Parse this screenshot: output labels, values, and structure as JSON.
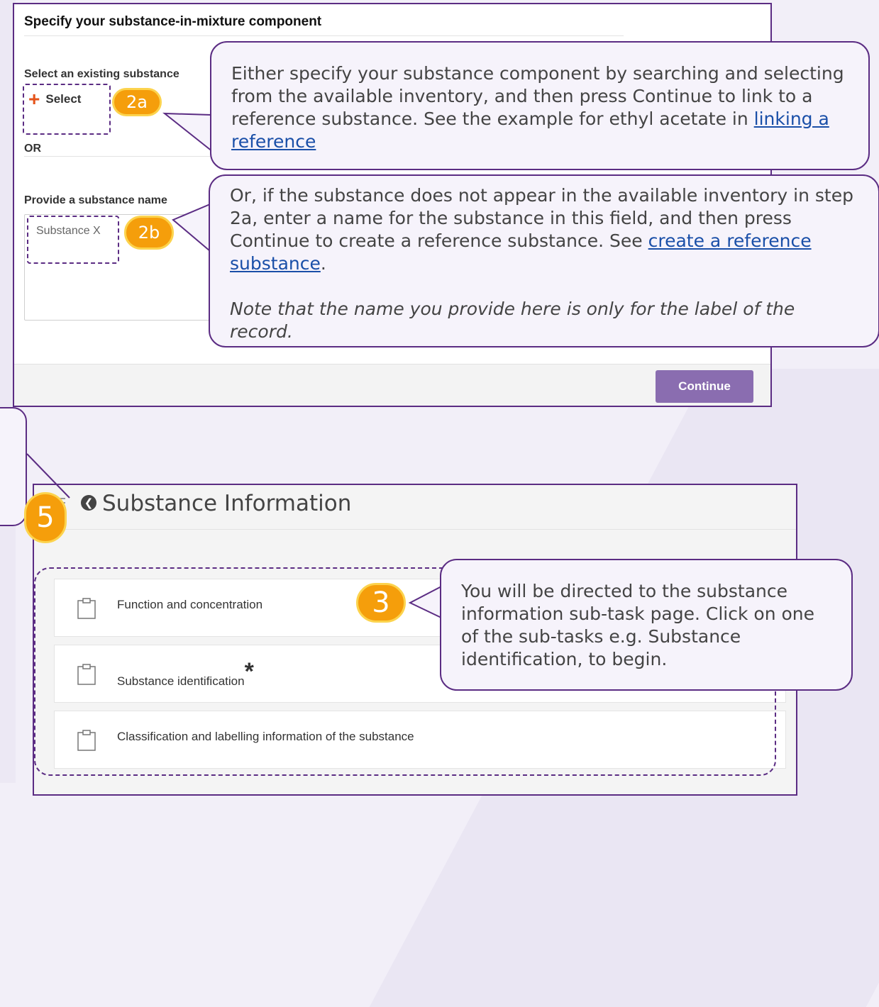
{
  "dialog": {
    "title": "Specify your substance-in-mixture component",
    "select_existing_label": "Select an existing substance",
    "select_button": "Select",
    "or_label": "OR",
    "provide_name_label": "Provide a substance name",
    "name_value": "Substance X",
    "continue_label": "Continue"
  },
  "badges": {
    "b2a": "2a",
    "b2b": "2b",
    "b3": "3",
    "b5": "5"
  },
  "callouts": {
    "c2a_text": "Either specify your substance component by searching and selecting from the available inventory, and then press Continue to link to a reference substance. See the example for ethyl acetate in ",
    "c2a_link": "linking a reference",
    "c2b_text": "Or, if the substance does not appear in the available inventory in step 2a, enter a name for the substance in this field, and then press Continue to create a reference substance. See ",
    "c2b_link": "create a reference substance",
    "c2b_end": ".",
    "c2b_note": "Note that the name you provide here is only for the label of the record.",
    "c3_text": "You will be directed to the substance information sub-task page. Click on one of the sub-tasks e.g. Substance identification, to begin."
  },
  "substance_info": {
    "title": "Substance Information",
    "tasks": [
      {
        "label": "Function and concentration",
        "required": ""
      },
      {
        "label": "Substance identification",
        "required": "*"
      },
      {
        "label": "Classification and labelling information of the substance",
        "required": ""
      }
    ]
  },
  "colors": {
    "accent_purple": "#5b2c83",
    "continue_button": "#8a6db0",
    "badge_orange": "#f59e0b",
    "link_blue": "#1a4fa8",
    "select_plus": "#e5531a"
  }
}
